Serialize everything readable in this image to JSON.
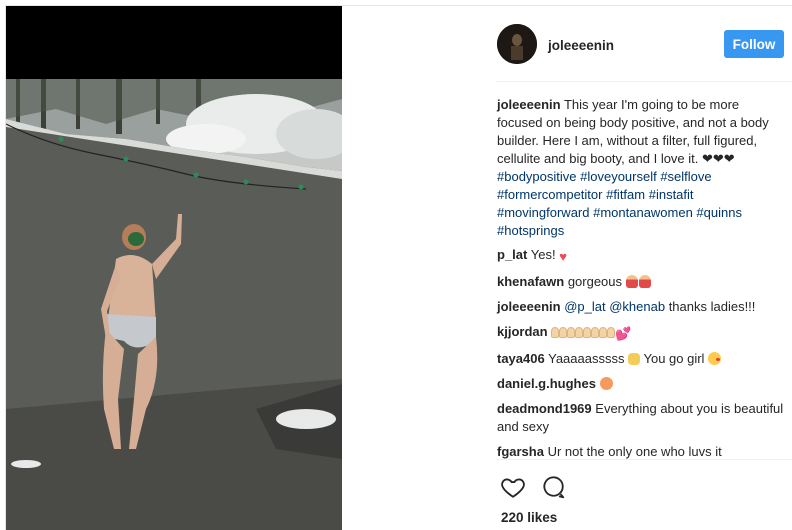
{
  "header": {
    "username": "joleeeenin",
    "follow_label": "Follow"
  },
  "caption": {
    "username": "joleeeenin",
    "text": "This year I'm going to be more focused on being body positive, and not a body builder. Here I am, without a filter, full figured, cellulite and big booty, and I love it.",
    "hearts": "❤❤❤",
    "hashtags": "#bodypositive #loveyourself #selflove #formercompetitor #fitfam #instafit #movingforward #montanawomen #quinns #hotsprings"
  },
  "comments": [
    {
      "username": "p_lat",
      "text": "Yes!",
      "emoji": "heart"
    },
    {
      "username": "khenafawn",
      "text": "gorgeous",
      "emoji": "dancers"
    },
    {
      "username": "joleeeenin",
      "mentions": "@p_lat @khenab",
      "text": "thanks ladies!!!"
    },
    {
      "username": "kjjordan",
      "text": "",
      "emoji": "claps-hearts"
    },
    {
      "username": "taya406",
      "text": "Yaaaaasssss",
      "text2": "You go girl",
      "emoji": "raised-hands kiss"
    },
    {
      "username": "daniel.g.hughes",
      "text": "",
      "emoji": "peach"
    },
    {
      "username": "deadmond1969",
      "text": "Everything about you is beautiful and sexy"
    },
    {
      "username": "fgarsha",
      "text": "Ur not the only one who luvs it"
    }
  ],
  "footer": {
    "likes": "220 likes"
  },
  "colors": {
    "follow": "#3897f0",
    "link": "#003569",
    "like_heart": "#ed4956"
  },
  "icons": [
    "heart-outline-icon",
    "comment-bubble-icon"
  ]
}
